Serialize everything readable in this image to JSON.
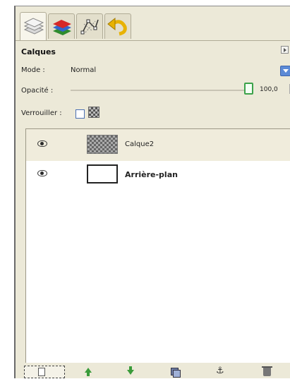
{
  "tabs": [
    {
      "name": "layers",
      "icon": "layers-icon",
      "active": true
    },
    {
      "name": "channels",
      "icon": "channels-icon",
      "active": false
    },
    {
      "name": "paths",
      "icon": "paths-icon",
      "active": false
    },
    {
      "name": "undo-history",
      "icon": "undo-icon",
      "active": false
    }
  ],
  "panel": {
    "title": "Calques"
  },
  "mode": {
    "label": "Mode :",
    "value": "Normal"
  },
  "opacity": {
    "label": "Opacité :",
    "value": "100,0",
    "level_percent": 100
  },
  "lock": {
    "label": "Verrouiller :"
  },
  "layers": [
    {
      "name": "Calque2",
      "selected": true,
      "visible": true,
      "thumbnail": "transparent-checker",
      "bold": false
    },
    {
      "name": "Arrière-plan",
      "selected": false,
      "visible": true,
      "thumbnail": "white",
      "bold": true
    }
  ],
  "bottom_buttons": [
    {
      "name": "new-layer",
      "icon": "new-layer-icon"
    },
    {
      "name": "raise-layer",
      "icon": "arrow-up-icon"
    },
    {
      "name": "lower-layer",
      "icon": "arrow-down-icon"
    },
    {
      "name": "duplicate-layer",
      "icon": "duplicate-icon"
    },
    {
      "name": "anchor-layer",
      "icon": "anchor-icon"
    },
    {
      "name": "delete-layer",
      "icon": "trash-icon"
    }
  ],
  "colors": {
    "selection": "#f0ecdc",
    "slider_handle": "#3ca24a",
    "dropdown_arrow": "#5c8ad6"
  }
}
